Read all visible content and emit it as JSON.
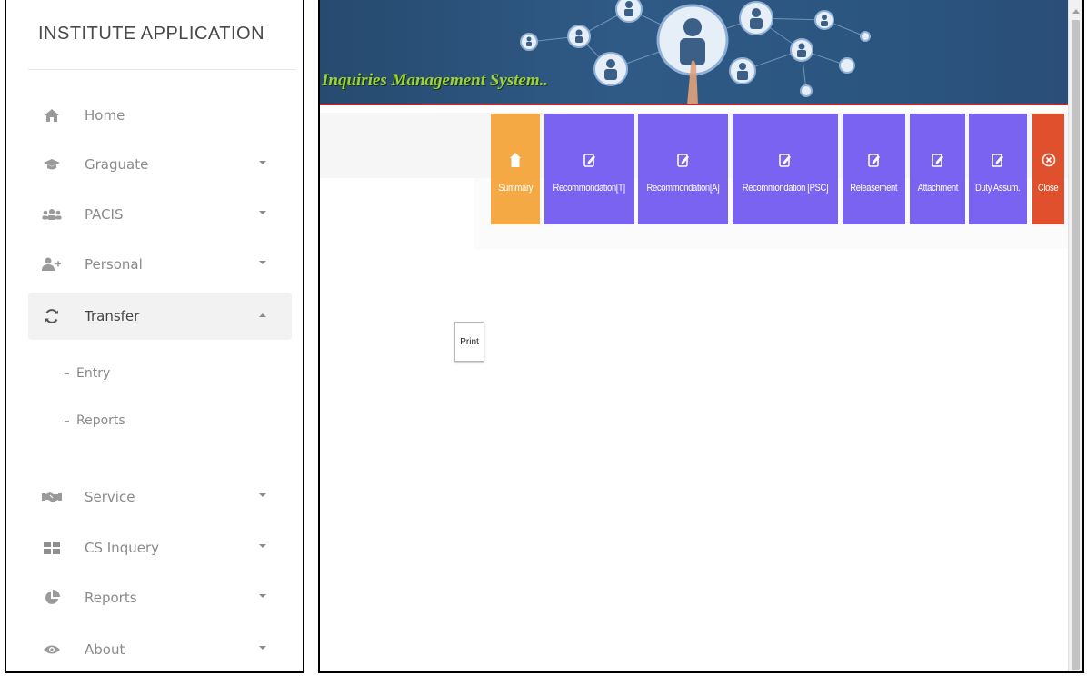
{
  "sidebar": {
    "app_title": "INSTITUTE APPLICATION",
    "items": [
      {
        "label": "Home",
        "icon": "home-icon"
      },
      {
        "label": "Graguate",
        "icon": "graduation-cap-icon"
      },
      {
        "label": "PACIS",
        "icon": "users-group-icon"
      },
      {
        "label": "Personal",
        "icon": "user-plus-icon"
      },
      {
        "label": "Transfer",
        "icon": "refresh-icon",
        "expanded": true
      },
      {
        "label": "Service",
        "icon": "handshake-icon"
      },
      {
        "label": "CS Inquery",
        "icon": "grid-icon"
      },
      {
        "label": "Reports",
        "icon": "pie-chart-icon"
      },
      {
        "label": "About",
        "icon": "eye-icon"
      }
    ],
    "transfer_sub": [
      "Entry",
      "Reports"
    ]
  },
  "banner": {
    "title": "Inquiries Management System..",
    "accent_line_color": "#c8242c"
  },
  "toolbar": {
    "buttons": [
      {
        "label": "Summary",
        "icon": "home-icon",
        "color": "#f5a944"
      },
      {
        "label": "Recommondation[T]",
        "icon": "edit-icon",
        "color": "#7b63f2"
      },
      {
        "label": "Recommondation[A]",
        "icon": "edit-icon",
        "color": "#7b63f2"
      },
      {
        "label": "Recommondation [PSC]",
        "icon": "edit-icon",
        "color": "#7b63f2"
      },
      {
        "label": "Releasement",
        "icon": "edit-icon",
        "color": "#7b63f2"
      },
      {
        "label": "Attachment",
        "icon": "edit-icon",
        "color": "#7b63f2"
      },
      {
        "label": "Duty Assum.",
        "icon": "edit-icon",
        "color": "#7b63f2"
      },
      {
        "label": "Close",
        "icon": "close-circle-icon",
        "color": "#e0502c"
      }
    ]
  },
  "print": {
    "label": "Print"
  }
}
